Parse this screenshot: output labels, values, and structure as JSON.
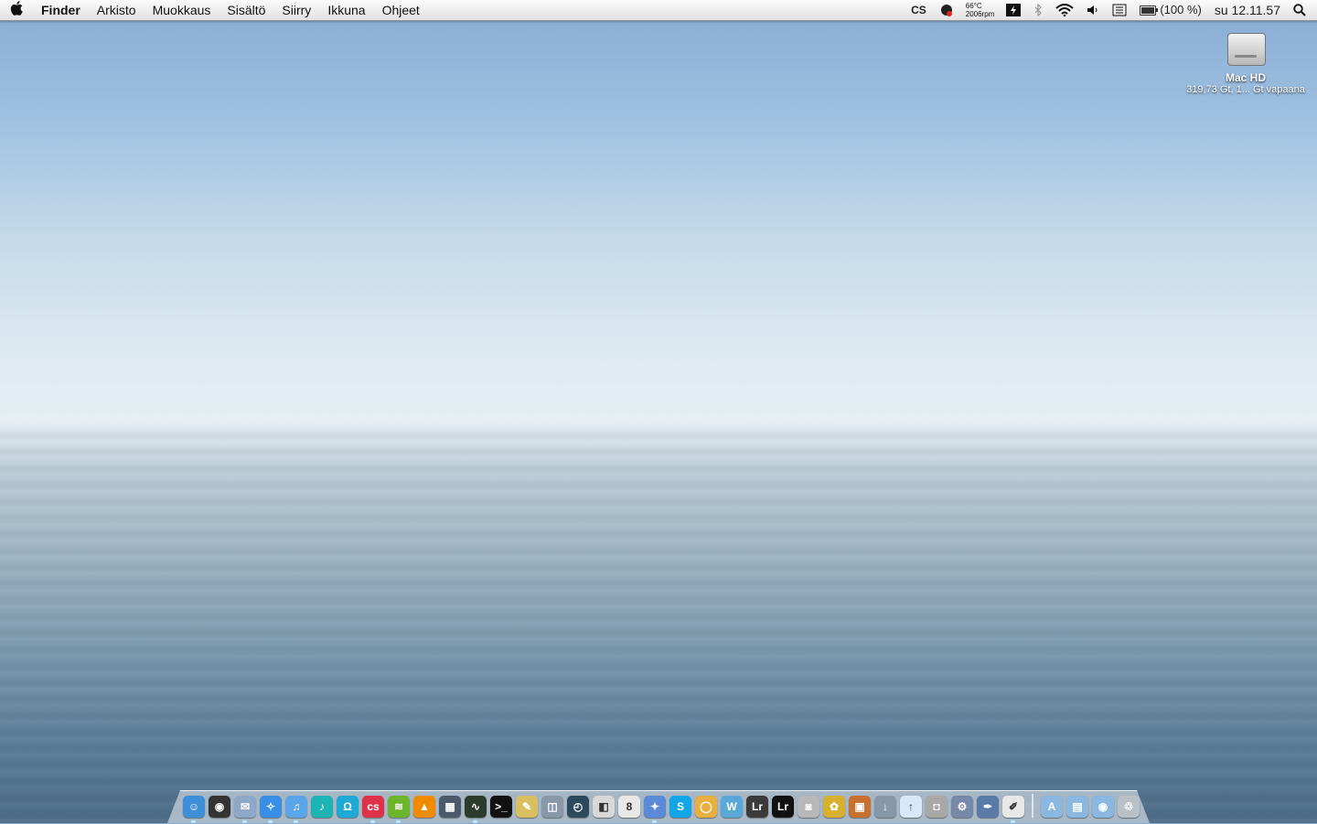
{
  "menubar": {
    "apple": "",
    "items": [
      "Finder",
      "Arkisto",
      "Muokkaus",
      "Sisältö",
      "Siirry",
      "Ikkuna",
      "Ohjeet"
    ],
    "tray": {
      "lastfm": "CS",
      "temp": "66°C",
      "rpm": "2006rpm",
      "battery_pct": "(100 %)",
      "battery_level": 1.0,
      "clock": "su 12.11.57"
    }
  },
  "desktop": {
    "hd_name": "Mac HD",
    "hd_info": "319,73 Gt, 1... Gt vapaana"
  },
  "dock": {
    "apps": [
      {
        "icon": "finder-icon",
        "color": "#3d8fd8",
        "glyph": "☺",
        "running": true
      },
      {
        "icon": "dashboard-icon",
        "color": "#333333",
        "glyph": "◉",
        "running": false
      },
      {
        "icon": "mail-icon",
        "color": "#8fa8c8",
        "glyph": "✉",
        "running": true
      },
      {
        "icon": "safari-icon",
        "color": "#3a8ee6",
        "glyph": "✧",
        "running": true
      },
      {
        "icon": "itunes-icon",
        "color": "#5aa6e8",
        "glyph": "♫",
        "running": true
      },
      {
        "icon": "music-icon",
        "color": "#1fb4b4",
        "glyph": "♪",
        "running": false
      },
      {
        "icon": "headphones-icon",
        "color": "#1faad6",
        "glyph": "Ω",
        "running": false
      },
      {
        "icon": "lastfm-icon",
        "color": "#e0314b",
        "glyph": "cs",
        "running": true
      },
      {
        "icon": "spotify-icon",
        "color": "#6cb52d",
        "glyph": "≋",
        "running": true
      },
      {
        "icon": "vlc-icon",
        "color": "#f08a00",
        "glyph": "▲",
        "running": false
      },
      {
        "icon": "exposé-icon",
        "color": "#4a5a6a",
        "glyph": "▦",
        "running": false
      },
      {
        "icon": "activity-monitor-icon",
        "color": "#2c3c2c",
        "glyph": "∿",
        "running": true
      },
      {
        "icon": "terminal-icon",
        "color": "#111111",
        "glyph": ">_",
        "running": false
      },
      {
        "icon": "notes-icon",
        "color": "#d8c060",
        "glyph": "✎",
        "running": false
      },
      {
        "icon": "preview-icon",
        "color": "#8898a8",
        "glyph": "◫",
        "running": false
      },
      {
        "icon": "time-machine-icon",
        "color": "#2c4a5c",
        "glyph": "◴",
        "running": false
      },
      {
        "icon": "ical-icon",
        "color": "#d8d8d8",
        "glyph": "◧",
        "running": false
      },
      {
        "icon": "calendar-icon",
        "color": "#e8e8e8",
        "glyph": "8",
        "running": false
      },
      {
        "icon": "adium-icon",
        "color": "#5a8ad8",
        "glyph": "✦",
        "running": true
      },
      {
        "icon": "skype-icon",
        "color": "#12a5e8",
        "glyph": "S",
        "running": false
      },
      {
        "icon": "messages-icon",
        "color": "#e8b040",
        "glyph": "◯",
        "running": false
      },
      {
        "icon": "wunderlist-icon",
        "color": "#5aa8d8",
        "glyph": "W",
        "running": false
      },
      {
        "icon": "lightroom-icon",
        "color": "#3a3a3a",
        "glyph": "Lr",
        "running": false
      },
      {
        "icon": "lightroom2-icon",
        "color": "#111111",
        "glyph": "Lr",
        "running": false
      },
      {
        "icon": "camera-icon",
        "color": "#b8b8b8",
        "glyph": "◙",
        "running": false
      },
      {
        "icon": "iphoto-icon",
        "color": "#d8b030",
        "glyph": "✿",
        "running": false
      },
      {
        "icon": "photos-icon",
        "color": "#c87030",
        "glyph": "▣",
        "running": false
      },
      {
        "icon": "downloads-icon",
        "color": "#8898a8",
        "glyph": "↓",
        "running": false
      },
      {
        "icon": "flickr-upload-icon",
        "color": "#d8e8f8",
        "glyph": "↑",
        "running": false
      },
      {
        "icon": "screenshot-icon",
        "color": "#a8a8a8",
        "glyph": "◘",
        "running": false
      },
      {
        "icon": "system-prefs-icon",
        "color": "#7888a8",
        "glyph": "⚙",
        "running": false
      },
      {
        "icon": "pen-icon",
        "color": "#5a7aa8",
        "glyph": "✒",
        "running": false
      },
      {
        "icon": "textedit-icon",
        "color": "#e8e8e8",
        "glyph": "✐",
        "running": true
      }
    ],
    "stacks": [
      {
        "icon": "applications-folder-icon",
        "color": "#8ab8e0",
        "glyph": "A"
      },
      {
        "icon": "documents-folder-icon",
        "color": "#8ab8e0",
        "glyph": "▤"
      },
      {
        "icon": "downloads-folder-icon",
        "color": "#8ab8e0",
        "glyph": "◉"
      },
      {
        "icon": "trash-icon",
        "color": "#b8c0c8",
        "glyph": "♲"
      }
    ]
  }
}
